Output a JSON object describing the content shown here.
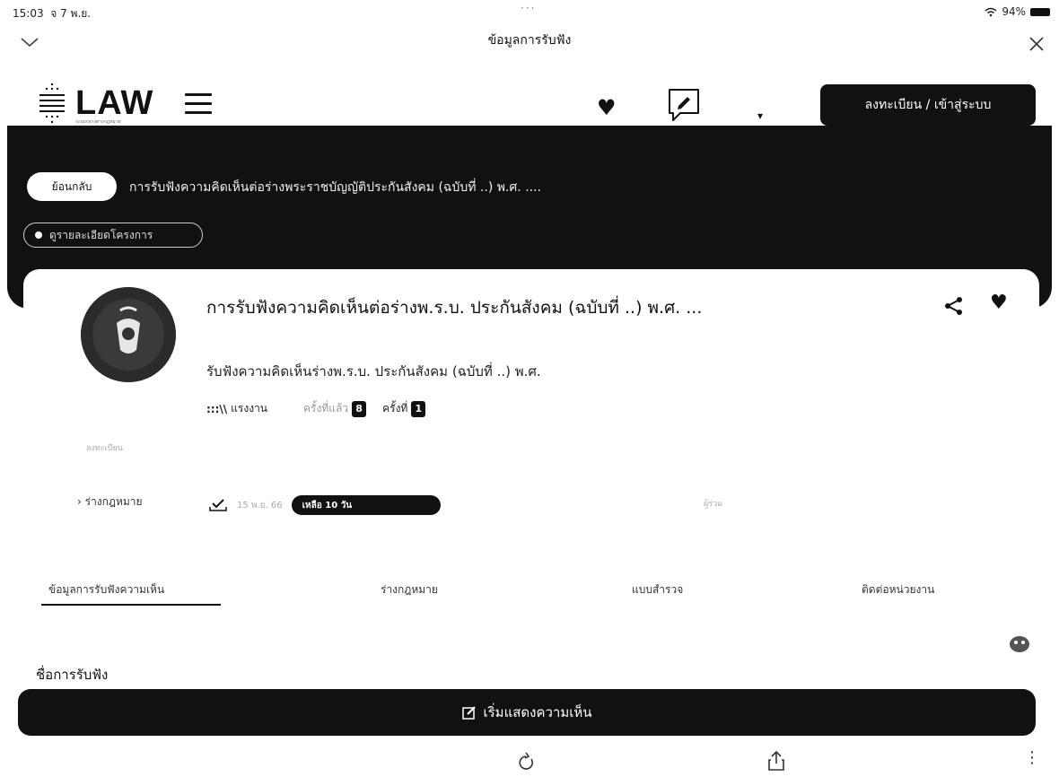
{
  "status_bar": {
    "time": "15:03",
    "date": "จ 7 พ.ย.",
    "dots": "···",
    "battery": "94%"
  },
  "sheet": {
    "title": "ข้อมูลการรับฟัง"
  },
  "header": {
    "logo_text": "LAW",
    "logo_subtext": "ระบบกลางทางกฎหมาย",
    "register_label": "ลงทะเบียน / เข้าสู่ระบบ"
  },
  "banner": {
    "back_label": "ย้อนกลับ",
    "title": "การรับฟังความคิดเห็นต่อร่างพระราชบัญญัติประกันสังคม (ฉบับที่ ..) พ.ศ. ....",
    "detail_label": "ดูรายละเอียดโครงการ"
  },
  "project": {
    "title": "การรับฟังความคิดเห็นต่อร่างพ.ร.บ. ประกันสังคม (ฉบับที่ ..) พ.ศ. ...",
    "subtitle": "รับฟังความคิดเห็นร่างพ.ร.บ. ประกันสังคม (ฉบับที่ ..) พ.ศ.",
    "agency_icon": ":::\\\\",
    "agency": "แรงงาน",
    "views_label": "ครั้งที่แล้ว",
    "views_count": "8",
    "round_label": "ครั้งที่",
    "round_count": "1",
    "law_label": "ลงทะเบียน",
    "drafts_label": "ร่างกฎหมาย",
    "date_label": "15 พ.ย. 66",
    "remaining_label": "เหลือ 10 วัน",
    "right_label": "ผู้ร่วม"
  },
  "tabs": [
    {
      "label": "ข้อมูลการรับฟังความเห็น"
    },
    {
      "label": "ร่างกฎหมาย"
    },
    {
      "label": "แบบสำรวจ"
    },
    {
      "label": "ติดต่อหน่วยงาน"
    }
  ],
  "section": {
    "label": "ชื่อการรับฟัง"
  },
  "action": {
    "start_label": "เริ่มแสดงความเห็น"
  },
  "icons": {
    "heart": "♥",
    "more": "⋮"
  }
}
